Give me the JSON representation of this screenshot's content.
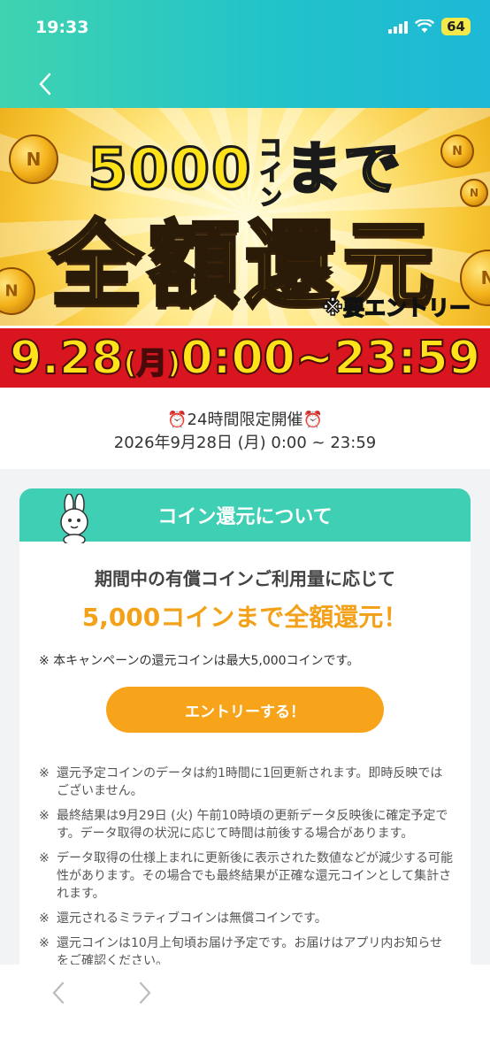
{
  "status": {
    "time": "19:33",
    "battery": "64"
  },
  "hero": {
    "title_num": "5000",
    "title_coin": "コイン",
    "title_made": "まで",
    "title_main": "全額還元",
    "note": "※要エントリー",
    "date_main": "9.28",
    "date_day": "(月)",
    "date_time": "0:00~23:59"
  },
  "info": {
    "line1_text": "24時間限定開催",
    "line2": "2026年9月28日 (月) 0:00 ~ 23:59"
  },
  "card": {
    "title": "コイン還元について",
    "subtitle": "期間中の有償コインご利用量に応じて",
    "headline": "5,000コインまで全額還元！",
    "top_note": "※ 本キャンペーンの還元コインは最大5,000コインです。",
    "entry_button": "エントリーする！",
    "notes": [
      {
        "mark": "※",
        "text": "還元予定コインのデータは約1時間に1回更新されます。即時反映ではございません。"
      },
      {
        "mark": "※",
        "text": "最終結果は9月29日 (火) 午前10時頃の更新データ反映後に確定予定です。データ取得の状況に応じて時間は前後する場合があります。"
      },
      {
        "mark": "※",
        "text": "データ取得の仕様上まれに更新後に表示された数値などが減少する可能性があります。その場合でも最終結果が正確な還元コインとして集計されます。"
      },
      {
        "mark": "※",
        "text": "還元されるミラティブコインは無償コインです。"
      },
      {
        "mark": "※",
        "text": "還元コインは10月上旬頃お届け予定です。お届けはアプリ内お知らせをご確認ください。"
      }
    ]
  },
  "colors": {
    "teal": "#3fcfb4",
    "orange": "#f8a41a",
    "red": "#d91520",
    "yellow": "#ffe21a"
  }
}
